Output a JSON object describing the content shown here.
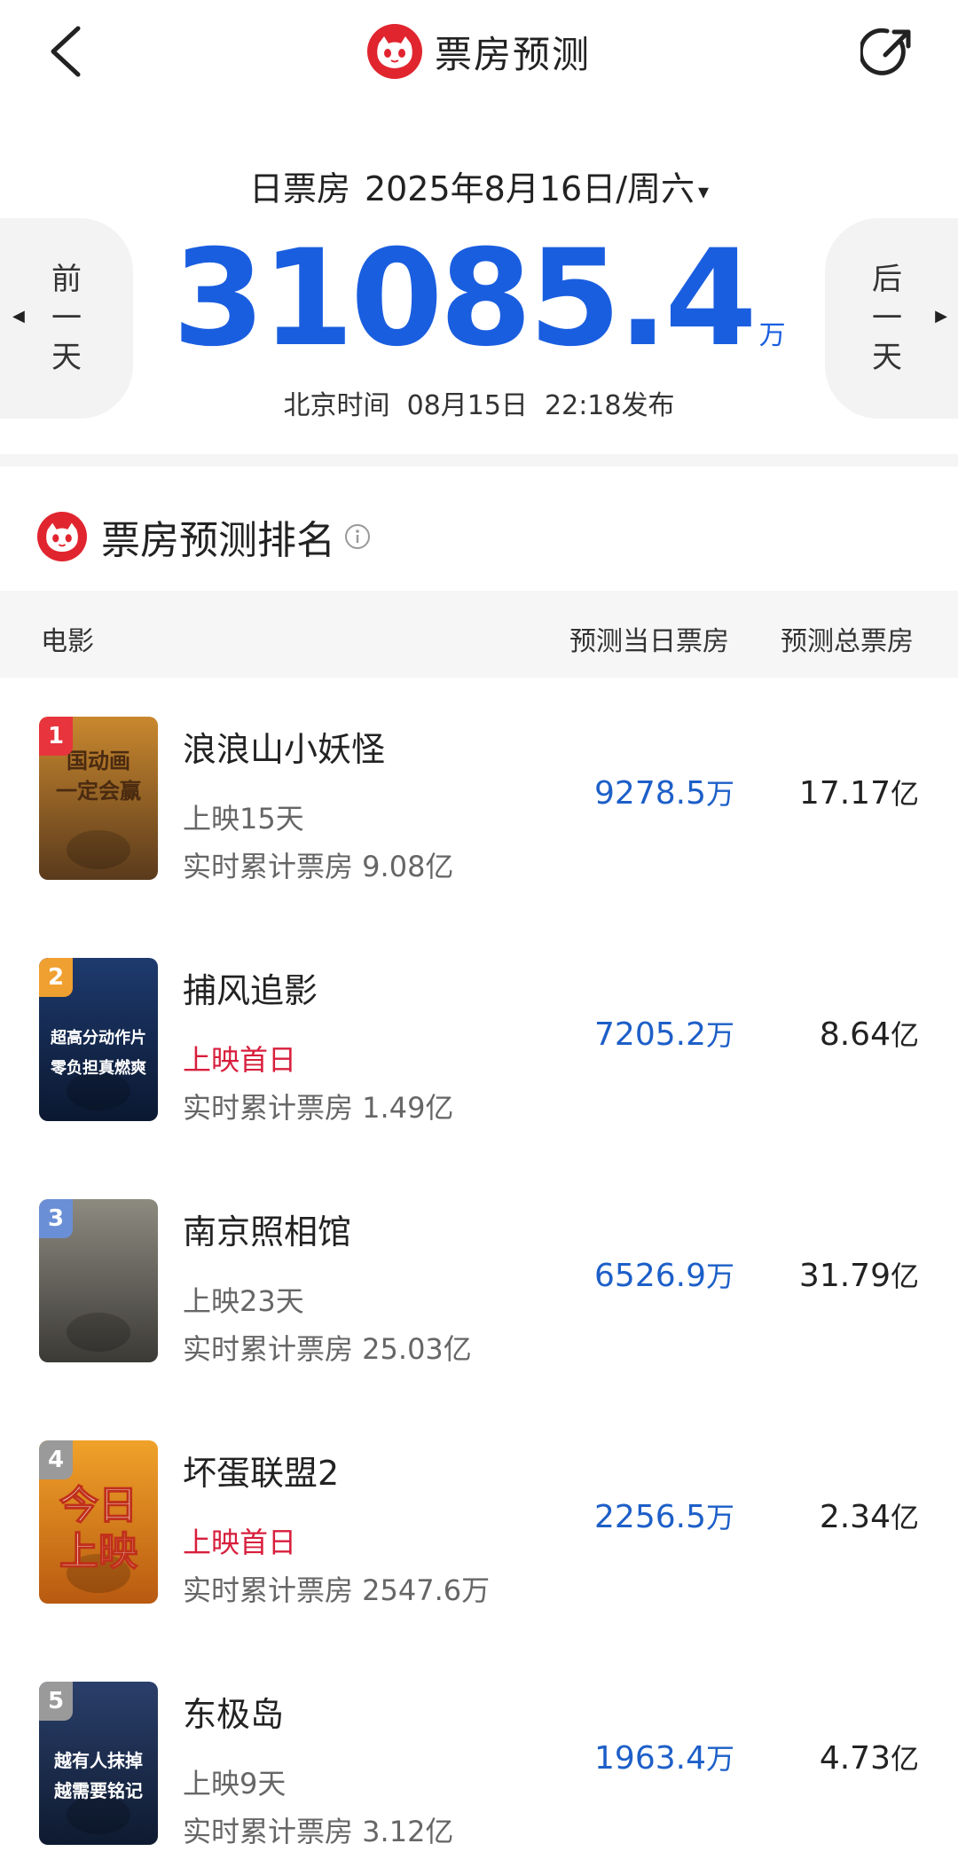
{
  "header": {
    "title": "票房预测",
    "back_icon": "chevron-left-icon",
    "share_icon": "share-icon",
    "brand_color": "#e1252f"
  },
  "date_bar": {
    "label": "日票房",
    "date": "2025年8月16日/周六",
    "caret": "▾"
  },
  "nav": {
    "prev": [
      "前",
      "一",
      "天"
    ],
    "next": [
      "后",
      "一",
      "天"
    ]
  },
  "summary": {
    "total": "31085.4",
    "unit": "万",
    "publish_label": "北京时间",
    "publish_date": "08月15日",
    "publish_time": "22:18发布",
    "accent_color": "#1a5ee0"
  },
  "ranking": {
    "title": "票房预测排名",
    "columns": {
      "movie": "电影",
      "pred_day": "预测当日票房",
      "pred_total": "预测总票房"
    },
    "items": [
      {
        "rank": "1",
        "name": "浪浪山小妖怪",
        "status": "上映15天",
        "status_first_day": false,
        "realtime": "实时累计票房 9.08亿",
        "pred_day": "9278.5",
        "pred_day_unit": "万",
        "pred_total": "17.17",
        "pred_total_unit": "亿",
        "badge_color": "#e8343c",
        "poster_text": [
          "国动画",
          "一定会赢"
        ]
      },
      {
        "rank": "2",
        "name": "捕风追影",
        "status": "上映首日",
        "status_first_day": true,
        "realtime": "实时累计票房 1.49亿",
        "pred_day": "7205.2",
        "pred_day_unit": "万",
        "pred_total": "8.64",
        "pred_total_unit": "亿",
        "badge_color": "#f0a030",
        "poster_text": [
          "超高分动作片",
          "零负担真燃爽"
        ]
      },
      {
        "rank": "3",
        "name": "南京照相馆",
        "status": "上映23天",
        "status_first_day": false,
        "realtime": "实时累计票房 25.03亿",
        "pred_day": "6526.9",
        "pred_day_unit": "万",
        "pred_total": "31.79",
        "pred_total_unit": "亿",
        "badge_color": "#6b8fd6",
        "poster_text": []
      },
      {
        "rank": "4",
        "name": "坏蛋联盟2",
        "status": "上映首日",
        "status_first_day": true,
        "realtime": "实时累计票房 2547.6万",
        "pred_day": "2256.5",
        "pred_day_unit": "万",
        "pred_total": "2.34",
        "pred_total_unit": "亿",
        "badge_color": "#9a9a9a",
        "poster_text": [
          "今日",
          "上映"
        ]
      },
      {
        "rank": "5",
        "name": "东极岛",
        "status": "上映9天",
        "status_first_day": false,
        "realtime": "实时累计票房 3.12亿",
        "pred_day": "1963.4",
        "pred_day_unit": "万",
        "pred_total": "4.73",
        "pred_total_unit": "亿",
        "badge_color": "#9a9a9a",
        "poster_text": [
          "越有人抹掉",
          "越需要铭记"
        ]
      }
    ]
  }
}
